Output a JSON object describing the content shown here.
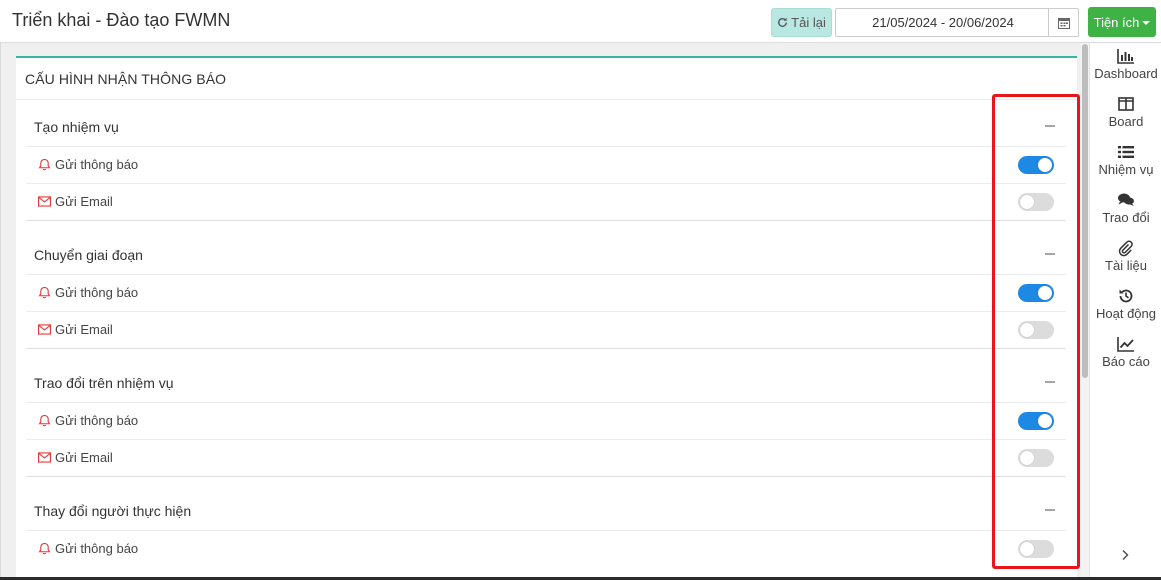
{
  "header": {
    "title": "Triển khai - Đào tạo FWMN",
    "reload_label": "Tải lại",
    "date_range": "21/05/2024 - 20/06/2024",
    "utilities_label": "Tiện ích"
  },
  "card": {
    "title": "CẤU HÌNH NHẬN THÔNG BÁO"
  },
  "sections": [
    {
      "title": "Tạo nhiệm vụ",
      "notify_label": "Gửi thông báo",
      "email_label": "Gửi Email",
      "notify_on": true,
      "email_on": false
    },
    {
      "title": "Chuyển giai đoạn",
      "notify_label": "Gửi thông báo",
      "email_label": "Gửi Email",
      "notify_on": true,
      "email_on": false
    },
    {
      "title": "Trao đổi trên nhiệm vụ",
      "notify_label": "Gửi thông báo",
      "email_label": "Gửi Email",
      "notify_on": true,
      "email_on": false
    },
    {
      "title": "Thay đổi người thực hiện",
      "notify_label": "Gửi thông báo",
      "notify_on": false
    }
  ],
  "rightnav": [
    {
      "label": "Dashboard",
      "icon": "bar-chart-icon"
    },
    {
      "label": "Board",
      "icon": "columns-icon"
    },
    {
      "label": "Nhiệm vụ",
      "icon": "list-icon"
    },
    {
      "label": "Trao đổi",
      "icon": "comments-icon"
    },
    {
      "label": "Tài liệu",
      "icon": "paperclip-icon"
    },
    {
      "label": "Hoạt động",
      "icon": "history-icon"
    },
    {
      "label": "Báo cáo",
      "icon": "line-chart-icon"
    }
  ],
  "colors": {
    "accent_teal": "#37b7a3",
    "toggle_on": "#1e88e5",
    "utilities_green": "#3fb246",
    "highlight_red": "#e8151b",
    "icon_red": "#e53935"
  }
}
